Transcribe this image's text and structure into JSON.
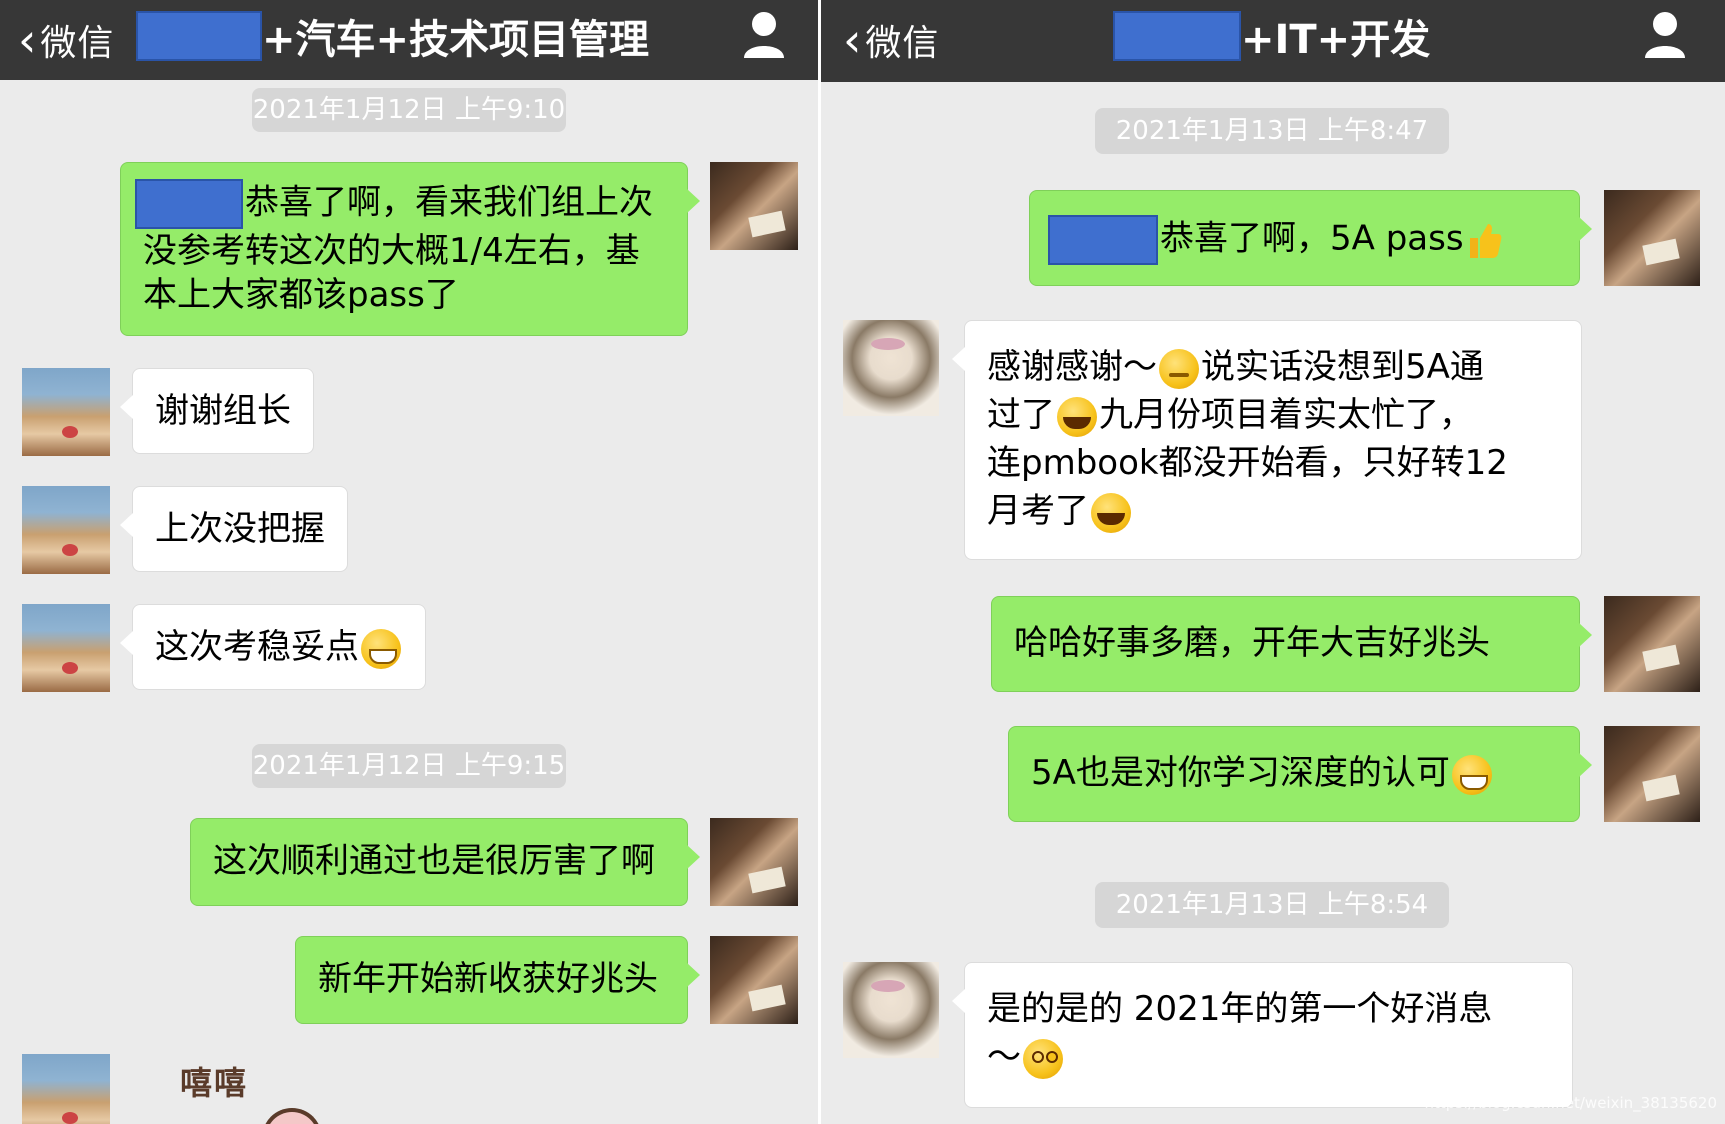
{
  "left": {
    "nav": {
      "back_label": "微信",
      "title": "+汽车+技术项目管理"
    },
    "timestamps": [
      "2021年1月12日 上午9:10",
      "2021年1月12日 上午9:15"
    ],
    "messages": [
      {
        "lines": [
          "恭喜了啊，看来我们组上次",
          "没参考转这次的大概1/4左右，基",
          "本上大家都该pass了"
        ]
      },
      {
        "text": "谢谢组长"
      },
      {
        "text": "上次没把握"
      },
      {
        "text": "这次考稳妥点"
      },
      {
        "text": "这次顺利通过也是很厉害了啊"
      },
      {
        "text": "新年开始新收获好兆头"
      }
    ],
    "sticker_text": "嘻嘻"
  },
  "right": {
    "nav": {
      "back_label": "微信",
      "title": "+IT+开发"
    },
    "timestamps": [
      "2021年1月13日 上午8:47",
      "2021年1月13日 上午8:54"
    ],
    "messages": [
      {
        "text": "恭喜了啊，5A pass"
      },
      {
        "l1a": "感谢感谢～",
        "l1b": "说实话没想到5A通",
        "l2a": "过了",
        "l2b": "九月份项目着实太忙了，",
        "l3": "连pmbook都没开始看，只好转12",
        "l4": "月考了"
      },
      {
        "text": "哈哈好事多磨，开年大吉好兆头"
      },
      {
        "text": "5A也是对你学习深度的认可"
      },
      {
        "l1": "是的是的 2021年的第一个好消息",
        "l2": "～"
      }
    ]
  },
  "watermark": "https://blog.csdn.net/weixin_38135620",
  "colors": {
    "navbar": "#373737",
    "chat_bg": "#ebebeb",
    "self_bubble": "#95ec69",
    "other_bubble": "#ffffff",
    "timestamp_bg": "#d6d6d6",
    "redaction": "#3f6fcf"
  },
  "icons": [
    "back-chevron-icon",
    "user-profile-icon",
    "grin-emoji",
    "smirk-emoji",
    "cry-laugh-emoji",
    "dizzy-emoji",
    "thumbs-up-emoji"
  ]
}
